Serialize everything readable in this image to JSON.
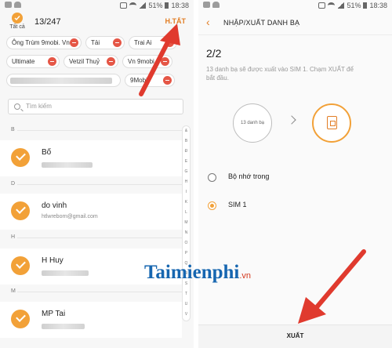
{
  "left": {
    "status": {
      "time": "18:38",
      "battery": "51%"
    },
    "select_all_label": "Tất cả",
    "count": "13/247",
    "done_label": "H.TẤT",
    "chips": [
      {
        "label": "Ông Trùm 9mobi. Vn"
      },
      {
        "label": "Tải"
      },
      {
        "label": "Trai Ai"
      },
      {
        "label": "Ultimate"
      },
      {
        "label": "Vetzil Thuỷ"
      },
      {
        "label": "Vn 9mobi"
      },
      {
        "label": "9Mobi"
      }
    ],
    "search_placeholder": "Tìm kiếm",
    "sections": [
      {
        "letter": "B",
        "name": "Bố",
        "sub": ""
      },
      {
        "letter": "D",
        "name": "do vinh",
        "sub": "htlwreborn@gmail.com"
      },
      {
        "letter": "H",
        "name": "H Huy",
        "sub": ""
      },
      {
        "letter": "M",
        "name": "MP Tai",
        "sub": ""
      }
    ],
    "index_letters": [
      "&",
      "B",
      "Đ",
      "E",
      "G",
      "H",
      "I",
      "K",
      "L",
      "M",
      "N",
      "O",
      "P",
      "Q",
      "R",
      "S",
      "T",
      "U",
      "V",
      "X",
      "Y"
    ]
  },
  "right": {
    "status": {
      "time": "18:38",
      "battery": "51%"
    },
    "title": "NHẬP/XUẤT DANH BẠ",
    "step": "2/2",
    "description": "13 danh bạ sẽ được xuất vào SIM 1. Chạm XUẤT để bắt đầu.",
    "source_label": "13 danh bạ",
    "options": [
      {
        "label": "Bộ nhớ trong",
        "selected": false
      },
      {
        "label": "SIM 1",
        "selected": true
      }
    ],
    "export_label": "XUẤT"
  },
  "watermark": {
    "text": "Taimienphi",
    "suffix": ".vn"
  },
  "colors": {
    "accent": "#f2a138",
    "arrow": "#e03a2e"
  }
}
